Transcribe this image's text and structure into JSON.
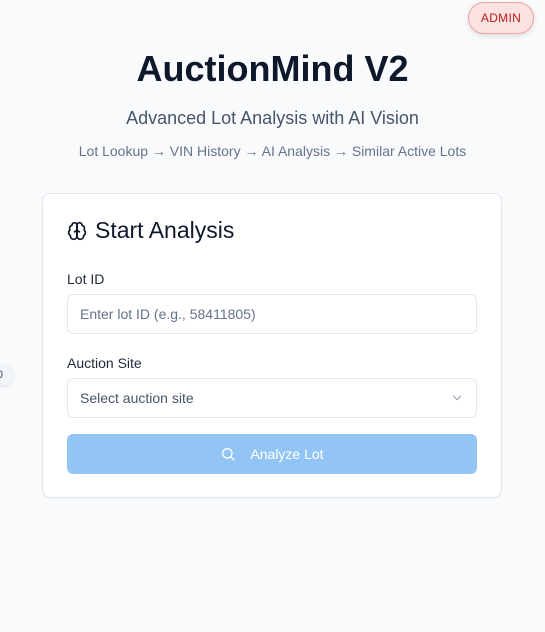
{
  "header": {
    "admin_badge": "ADMIN",
    "title": "AuctionMind V2",
    "subtitle": "Advanced Lot Analysis with AI Vision",
    "workflow": "Lot Lookup → VIN History → AI Analysis → Similar Active Lots"
  },
  "side_peek": {
    "text": "0"
  },
  "card": {
    "icon": "brain-icon",
    "title": "Start Analysis",
    "lot_id": {
      "label": "Lot ID",
      "value": "",
      "placeholder": "Enter lot ID (e.g., 58411805)"
    },
    "auction_site": {
      "label": "Auction Site",
      "selected": "Select auction site",
      "icon": "chevron-down-icon"
    },
    "analyze": {
      "label": "Analyze Lot",
      "icon": "search-icon",
      "disabled": true
    }
  },
  "colors": {
    "background": "#f8fafc",
    "admin_bg": "#fde2e2",
    "admin_text": "#b91c1c",
    "button_disabled": "#93c5f4",
    "card_border": "#e2e8f0"
  }
}
